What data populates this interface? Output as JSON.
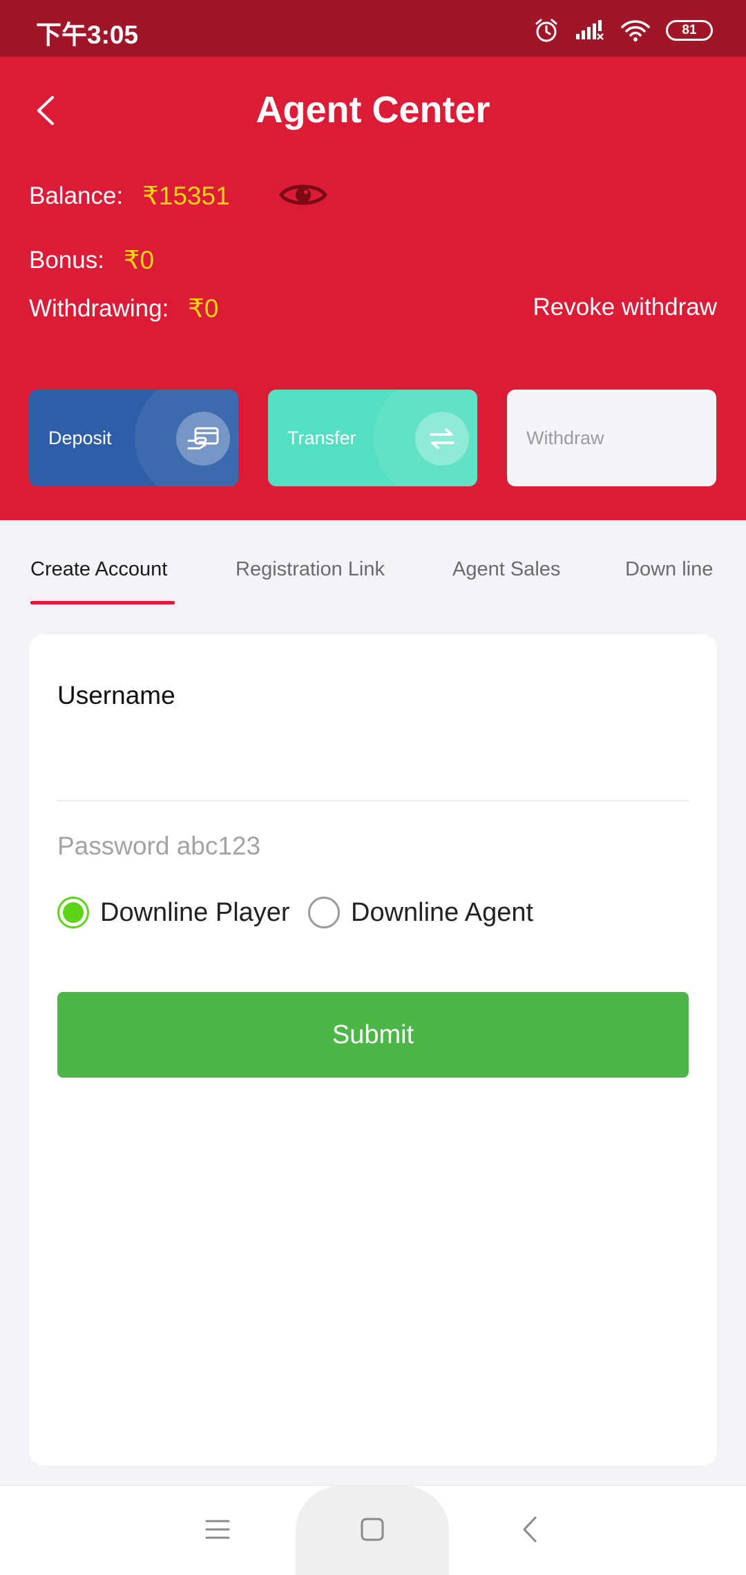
{
  "status_bar": {
    "time": "下午3:05",
    "battery": "81"
  },
  "header": {
    "title": "Agent Center",
    "balance_label": "Balance:",
    "balance_value": "₹15351",
    "bonus_label": "Bonus:",
    "bonus_value": "₹0",
    "withdrawing_label": "Withdrawing:",
    "withdrawing_value": "₹0",
    "revoke_label": "Revoke withdraw"
  },
  "actions": {
    "deposit_label": "Deposit",
    "transfer_label": "Transfer",
    "withdraw_label": "Withdraw"
  },
  "tabs": [
    {
      "label": "Create Account",
      "active": true
    },
    {
      "label": "Registration Link",
      "active": false
    },
    {
      "label": "Agent Sales",
      "active": false
    },
    {
      "label": "Down line",
      "active": false
    }
  ],
  "form": {
    "username_label": "Username",
    "username_value": "",
    "password_placeholder": "Password abc123",
    "option_player": "Downline Player",
    "option_agent": "Downline Agent",
    "selected_option": "Downline Player",
    "submit_label": "Submit"
  },
  "colors": {
    "header": "#dc1c36",
    "status_bar": "#a11528",
    "amount": "#ffd60a",
    "deposit_card": "#2f5ea8",
    "transfer_card": "#55dfc2",
    "submit": "#4cb648",
    "radio_checked": "#5ed31a"
  },
  "icons": [
    "alarm-icon",
    "signal-icon",
    "wifi-icon",
    "back-arrow-icon",
    "eye-icon",
    "deposit-card-icon",
    "transfer-arrows-icon",
    "menu-icon",
    "home-square-icon",
    "nav-back-icon"
  ]
}
